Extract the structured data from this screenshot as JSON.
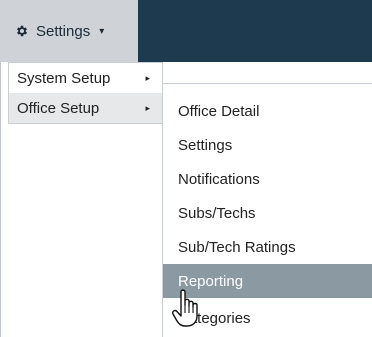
{
  "settings_button": {
    "label": "Settings",
    "icon": "gear-icon",
    "caret": "▾"
  },
  "submenu": {
    "items": [
      {
        "label": "System Setup",
        "arrow": "▸",
        "active": false
      },
      {
        "label": "Office Setup",
        "arrow": "▸",
        "active": true
      }
    ]
  },
  "office_menu": {
    "items": [
      {
        "label": "Office Detail"
      },
      {
        "label": "Settings"
      },
      {
        "label": "Notifications"
      },
      {
        "label": "Subs/Techs"
      },
      {
        "label": "Sub/Tech Ratings"
      },
      {
        "label": "Reporting",
        "hovered": true
      },
      {
        "label": "Categories"
      }
    ]
  },
  "colors": {
    "topbar": "#1d3a4e",
    "settings_bg": "#cfd3d8",
    "active_item": "#e6e8ea",
    "hover_item": "#8a99a2"
  }
}
